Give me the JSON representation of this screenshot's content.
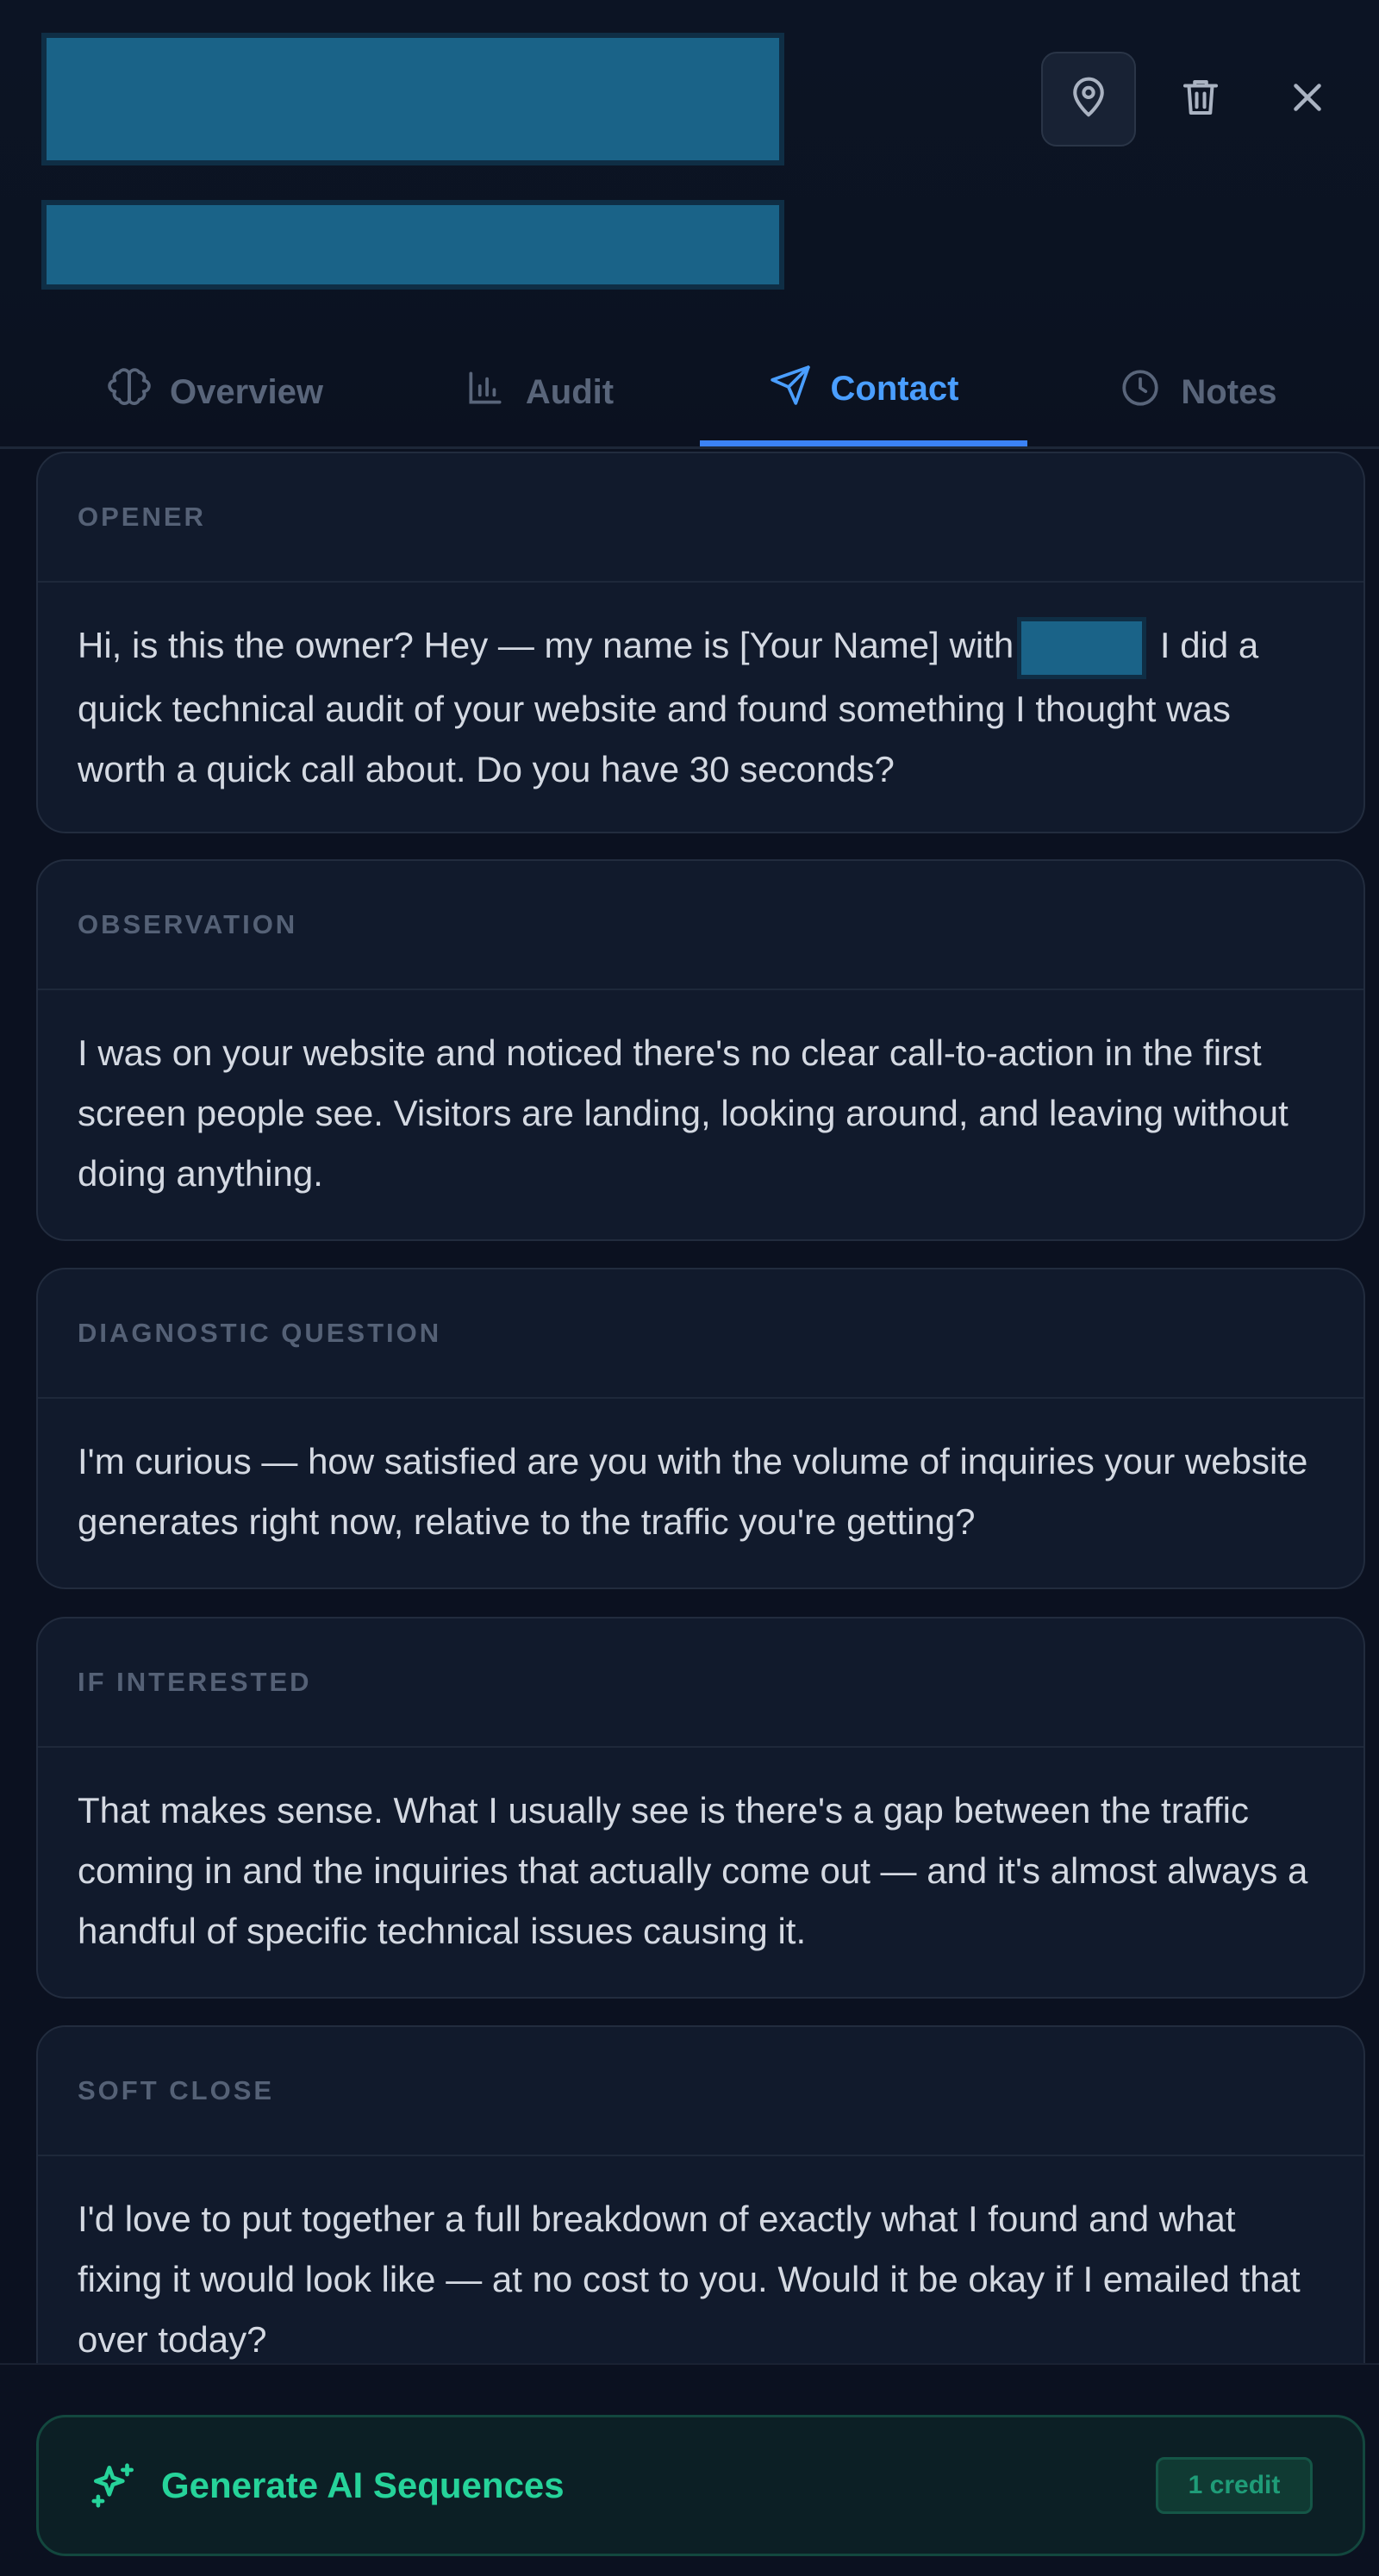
{
  "header": {
    "title_redacted": true,
    "subtitle_redacted": true,
    "actions": [
      {
        "name": "map-pin",
        "icon": "map-pin-icon"
      },
      {
        "name": "delete",
        "icon": "trash-icon"
      },
      {
        "name": "close",
        "icon": "close-icon"
      }
    ]
  },
  "tabs": [
    {
      "label": "Overview",
      "icon": "brain-icon",
      "active": false
    },
    {
      "label": "Audit",
      "icon": "bar-chart-icon",
      "active": false
    },
    {
      "label": "Contact",
      "icon": "send-icon",
      "active": true
    },
    {
      "label": "Notes",
      "icon": "clock-icon",
      "active": false
    }
  ],
  "sections": [
    {
      "title": "OPENER",
      "text_before": "Hi, is this the owner? Hey — my name is [Your Name] with",
      "redacted": true,
      "text_after": "I did a quick technical audit of your website and found something I thought was worth a quick call about. Do you have 30 seconds?"
    },
    {
      "title": "OBSERVATION",
      "text": "I was on your website and noticed there's no clear call-to-action in the first screen people see. Visitors are landing, looking around, and leaving without doing anything."
    },
    {
      "title": "DIAGNOSTIC QUESTION",
      "text": "I'm curious — how satisfied are you with the volume of inquiries your website generates right now, relative to the traffic you're getting?"
    },
    {
      "title": "IF INTERESTED",
      "text": "That makes sense. What I usually see is there's a gap between the traffic coming in and the inquiries that actually come out — and it's almost always a handful of specific technical issues causing it."
    },
    {
      "title": "SOFT CLOSE",
      "text": "I'd love to put together a full breakdown of exactly what I found and what fixing it would look like — at no cost to you. Would it be okay if I emailed that over today?"
    }
  ],
  "footer": {
    "button_label": "Generate AI Sequences",
    "button_icon": "sparkles-icon",
    "credit_badge": "1 credit"
  },
  "colors": {
    "background": "#0b1120",
    "card": "#111a2c",
    "accent_blue": "#3b82f6",
    "accent_green": "#26d39a",
    "redaction": "#1a6388"
  }
}
